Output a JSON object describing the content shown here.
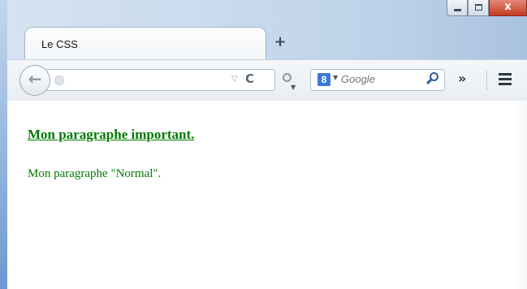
{
  "browser": {
    "tab": {
      "title": "Le CSS"
    },
    "new_tab_label": "+",
    "window_controls": {
      "minimize_icon": "minimize-icon",
      "maximize_icon": "maximize-icon",
      "close_label": "x"
    },
    "toolbar": {
      "back_icon": "back-arrow-icon",
      "url_value": "",
      "dropdown_label": "▽",
      "reload_label": "C",
      "search": {
        "engine_label": "8",
        "placeholder": "Google"
      },
      "overflow_label": "»",
      "menu_icon": "hamburger-menu-icon"
    }
  },
  "page": {
    "important_paragraph": "Mon paragraphe important.",
    "normal_paragraph": "Mon paragraphe \"Normal\"."
  },
  "colors": {
    "text_green": "#007a00",
    "search_icon_blue": "#3b78d8",
    "close_button_red": "#c43b22"
  }
}
